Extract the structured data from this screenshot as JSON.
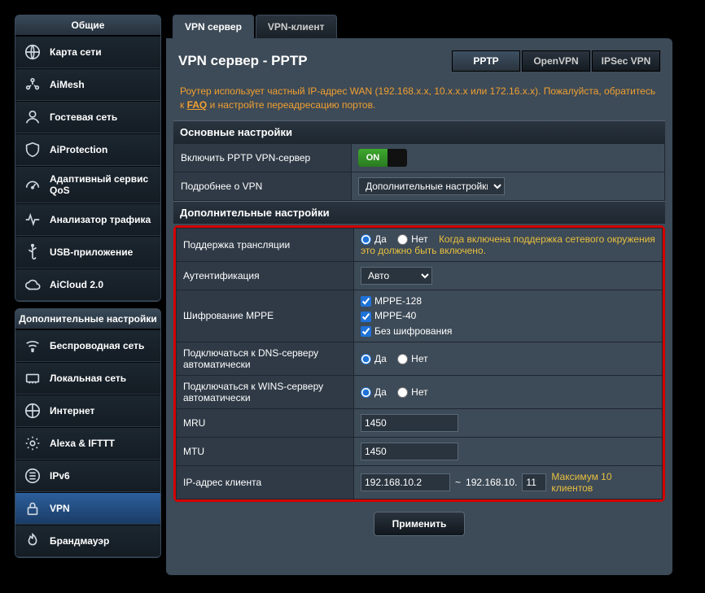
{
  "sidebar": {
    "general_header": "Общие",
    "advanced_header": "Дополнительные настройки",
    "general": [
      {
        "label": "Карта сети"
      },
      {
        "label": "AiMesh"
      },
      {
        "label": "Гостевая сеть"
      },
      {
        "label": "AiProtection"
      },
      {
        "label": "Адаптивный сервис QoS"
      },
      {
        "label": "Анализатор трафика"
      },
      {
        "label": "USB-приложение"
      },
      {
        "label": "AiCloud 2.0"
      }
    ],
    "advanced": [
      {
        "label": "Беспроводная сеть"
      },
      {
        "label": "Локальная сеть"
      },
      {
        "label": "Интернет"
      },
      {
        "label": "Alexa & IFTTT"
      },
      {
        "label": "IPv6"
      },
      {
        "label": "VPN",
        "active": true
      },
      {
        "label": "Брандмауэр"
      }
    ]
  },
  "tabs": {
    "server": "VPN сервер",
    "client": "VPN-клиент"
  },
  "page_title": "VPN сервер - PPTP",
  "modes": {
    "pptp": "PPTP",
    "openvpn": "OpenVPN",
    "ipsec": "IPSec VPN"
  },
  "notice": {
    "pre": "Роутер использует частный IP-адрес WAN (192.168.x.x, 10.x.x.x или 172.16.x.x). Пожалуйста, обратитесь к ",
    "faq": "FAQ",
    "post": " и настройте переадресацию портов."
  },
  "sections": {
    "basic": "Основные настройки",
    "advanced": "Дополнительные настройки"
  },
  "basic": {
    "enable_label": "Включить PPTP VPN-сервер",
    "enable_value": "ON",
    "details_label": "Подробнее о VPN",
    "details_select": "Дополнительные настройки"
  },
  "adv": {
    "broadcast_label": "Поддержка трансляции",
    "yes": "Да",
    "no": "Нет",
    "broadcast_hint": "Когда включена поддержка сетевого окружения это должно быть включено.",
    "auth_label": "Аутентификация",
    "auth_value": "Авто",
    "mppe_label": "Шифрование MPPE",
    "mppe128": "MPPE-128",
    "mppe40": "MPPE-40",
    "no_enc": "Без шифрования",
    "dns_label": "Подключаться к DNS-серверу автоматически",
    "wins_label": "Подключаться к WINS-серверу автоматически",
    "mru_label": "MRU",
    "mru_value": "1450",
    "mtu_label": "MTU",
    "mtu_value": "1450",
    "client_ip_label": "IP-адрес клиента",
    "ip_start": "192.168.10.2",
    "ip_sep": "~",
    "ip_prefix": "192.168.10.",
    "ip_end": "11",
    "ip_hint": "Максимум 10 клиентов"
  },
  "apply": "Применить"
}
